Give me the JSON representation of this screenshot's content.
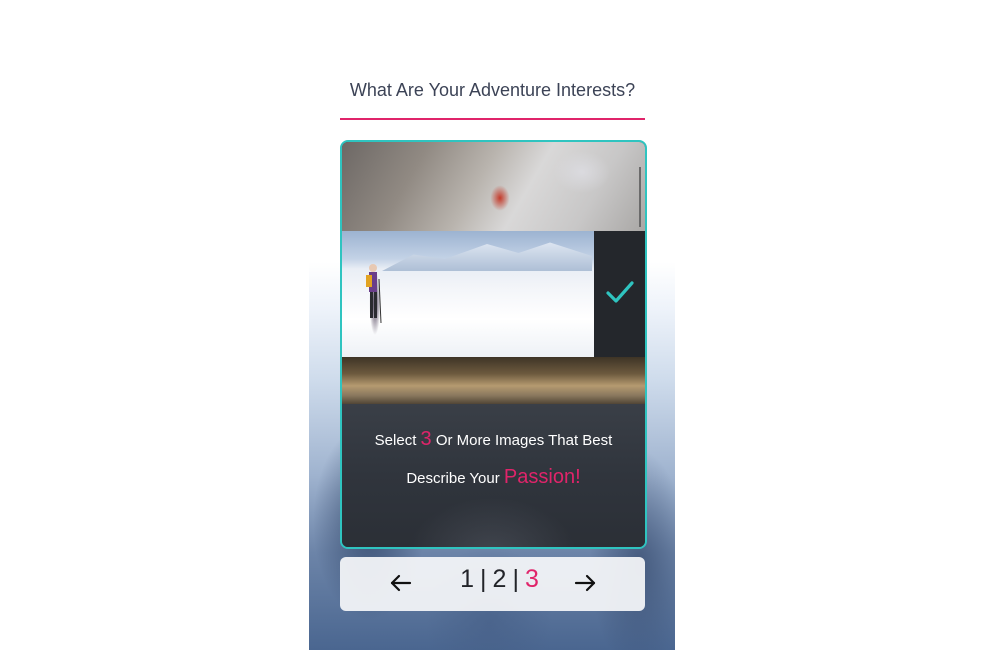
{
  "header": {
    "title": "What Are Your Adventure Interests?"
  },
  "gallery": {
    "items": [
      {
        "name": "mountain-climber",
        "selected": false
      },
      {
        "name": "backcountry-skier",
        "selected": true
      },
      {
        "name": "misty-lake",
        "selected": false
      }
    ],
    "instruction": {
      "prefix": "Select",
      "count": "3",
      "middle": "Or More Images That Best",
      "line2_prefix": "Describe Your",
      "highlight": "Passion!"
    }
  },
  "pager": {
    "pages": [
      "1",
      "2",
      "3"
    ],
    "current": "3",
    "separator": "|",
    "prev_icon": "arrow-left-icon",
    "next_icon": "arrow-right-icon"
  },
  "colors": {
    "accent": "#e0246a",
    "teal": "#2fc4c0",
    "text": "#3c4356"
  }
}
